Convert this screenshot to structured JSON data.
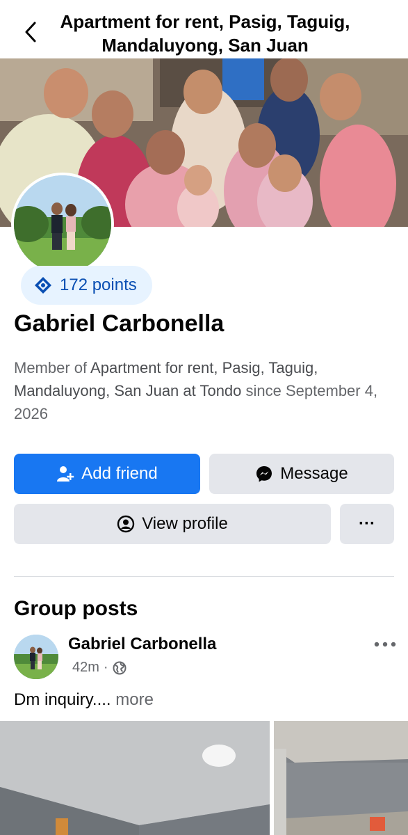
{
  "header": {
    "title": "Apartment for rent,  Pasig, Taguig, Mandaluyong, San Juan"
  },
  "profile": {
    "points_label": "172 points",
    "name": "Gabriel Carbonella",
    "member_prefix": "Member of ",
    "group_name": "Apartment for rent,  Pasig, Taguig, Mandaluyong, San Juan at Tondo",
    "member_suffix": " since ",
    "member_date": "September 4, 2026"
  },
  "actions": {
    "add_friend": "Add friend",
    "message": "Message",
    "view_profile": "View profile",
    "more": "···"
  },
  "group_posts": {
    "title": "Group posts",
    "post": {
      "author": "Gabriel Carbonella",
      "time": "42m",
      "audience_icon": "globe-icon",
      "text": "Dm inquiry....",
      "more_label": "more"
    }
  },
  "colors": {
    "accent": "#1877f2",
    "button_gray": "#e4e6eb",
    "points_bg": "#e7f3ff",
    "secondary_text": "#65676b"
  }
}
